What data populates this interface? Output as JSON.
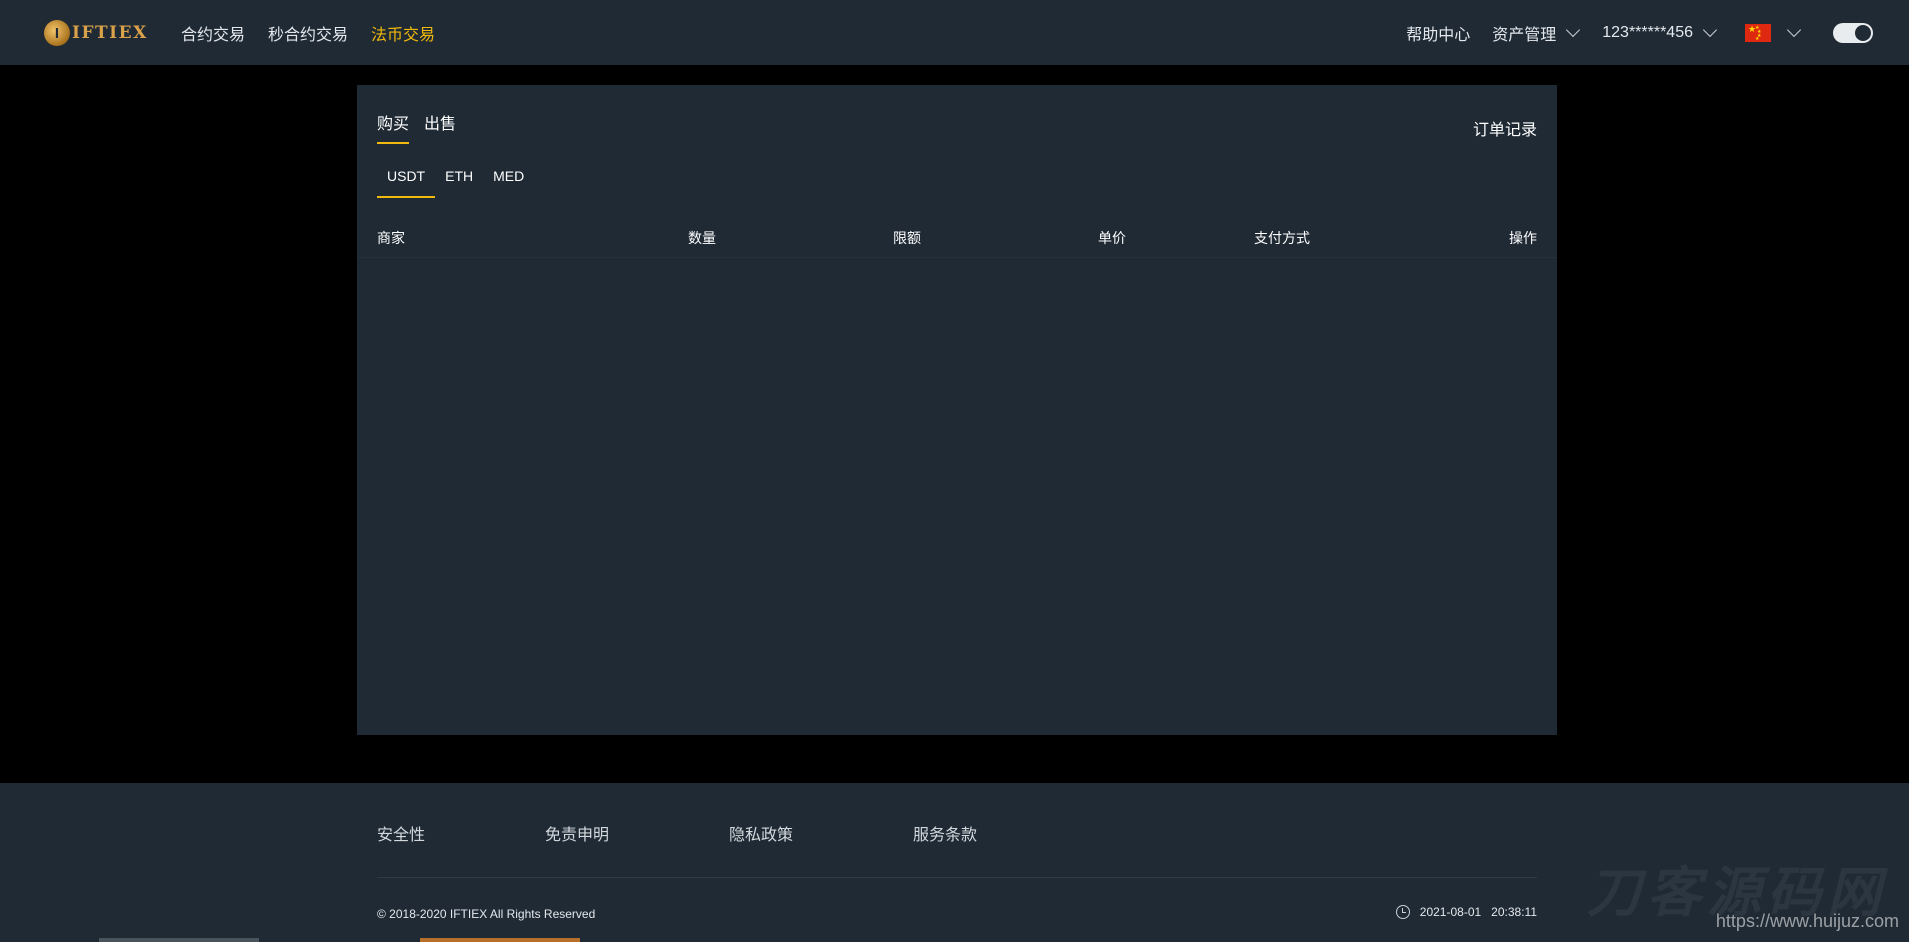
{
  "header": {
    "logo_letter": "I",
    "logo_text": "IFTIEX",
    "nav": [
      {
        "label": "合约交易",
        "active": false
      },
      {
        "label": "秒合约交易",
        "active": false
      },
      {
        "label": "法币交易",
        "active": true
      }
    ],
    "help_center": "帮助中心",
    "asset_management": "资产管理",
    "account": "123******456",
    "language_flag": "china-flag-icon"
  },
  "trade": {
    "tabs": [
      {
        "label": "购买",
        "active": true
      },
      {
        "label": "出售",
        "active": false
      }
    ],
    "order_record": "订单记录",
    "coins": [
      {
        "label": "USDT",
        "active": true
      },
      {
        "label": "ETH",
        "active": false
      },
      {
        "label": "MED",
        "active": false
      }
    ],
    "columns": [
      "商家",
      "数量",
      "限额",
      "单价",
      "支付方式",
      "操作"
    ]
  },
  "footer": {
    "links": [
      "安全性",
      "免责申明",
      "隐私政策",
      "服务条款"
    ],
    "copyright": "© 2018-2020 IFTIEX All Rights Reserved",
    "date": "2021-08-01",
    "time": "20:38:11",
    "watermark": "刀客源码网",
    "watermark_url": "https://www.huijuz.com"
  },
  "colors": {
    "accent": "#f0b90b",
    "panel": "#1f2a35",
    "background": "#000000"
  }
}
